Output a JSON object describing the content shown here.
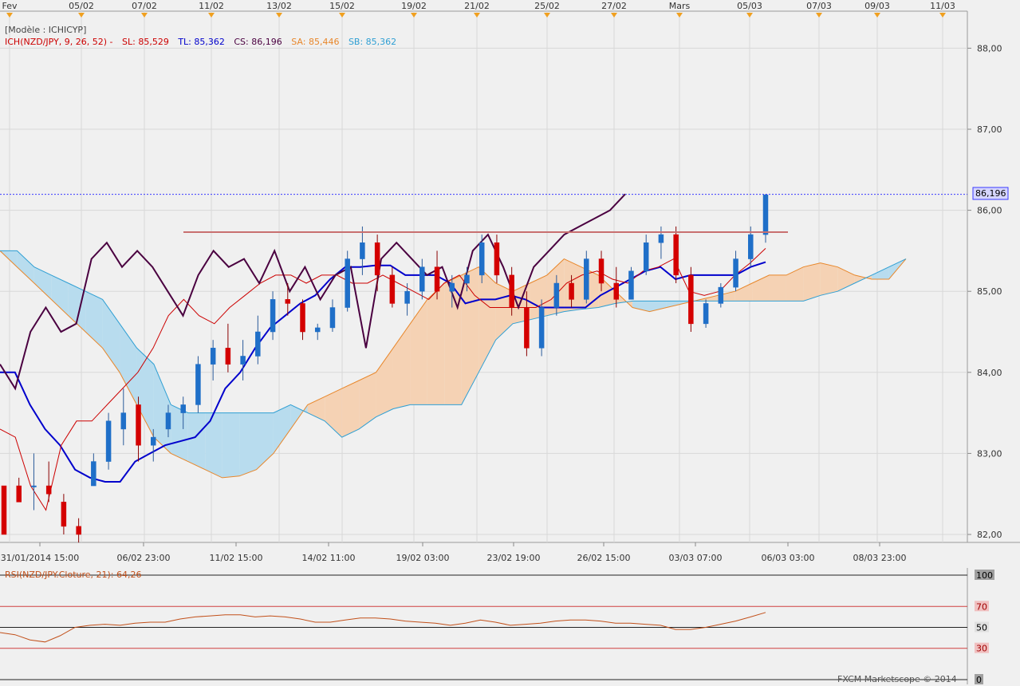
{
  "chart_data": {
    "type": "candlestick",
    "instrument": "NZD/JPY",
    "top_date_ticks": [
      "Fev",
      "05/02",
      "07/02",
      "11/02",
      "13/02",
      "15/02",
      "19/02",
      "21/02",
      "25/02",
      "27/02",
      "Mars",
      "05/03",
      "07/03",
      "09/03",
      "11/03"
    ],
    "bottom_time_ticks": [
      "31/01/2014 15:00",
      "06/02 23:00",
      "11/02 15:00",
      "14/02 11:00",
      "19/02 03:00",
      "23/02 19:00",
      "26/02 15:00",
      "03/03 07:00",
      "06/03 03:00",
      "08/03 23:00"
    ],
    "price_axis": {
      "ticks": [
        "88,00",
        "87,00",
        "86,00",
        "85,00",
        "84,00",
        "83,00",
        "82,00"
      ],
      "ylim": [
        81.95,
        88.5
      ]
    },
    "current_price_label": "86,196",
    "current_price": 86.196,
    "legend": {
      "model": "[Modèle : ICHICYP]",
      "ich": "ICH(NZD/JPY, 9, 26, 52) -",
      "sl": "SL: 85,529",
      "tl": "TL: 85,362",
      "cs": "CS: 86,196",
      "sa": "SA: 85,446",
      "sb": "SB: 85,362"
    },
    "resistance_level": 85.73,
    "series": {
      "senkou_a": [
        85.5,
        85.3,
        85.1,
        84.9,
        84.7,
        84.5,
        84.3,
        84.0,
        83.6,
        83.2,
        83.0,
        82.9,
        82.8,
        82.7,
        82.72,
        82.8,
        83.0,
        83.3,
        83.6,
        83.7,
        83.8,
        83.9,
        84.0,
        84.3,
        84.6,
        84.9,
        85.1,
        85.2,
        85.3,
        85.1,
        85.0,
        85.1,
        85.2,
        85.4,
        85.3,
        85.2,
        85.0,
        84.8,
        84.75,
        84.8,
        84.85,
        84.9,
        84.95,
        85.0,
        85.1,
        85.2,
        85.2,
        85.3,
        85.35,
        85.3,
        85.2,
        85.15,
        85.15,
        85.4,
        85.45
      ],
      "senkou_b": [
        85.5,
        85.5,
        85.3,
        85.2,
        85.1,
        85.0,
        84.9,
        84.6,
        84.3,
        84.1,
        83.6,
        83.5,
        83.5,
        83.5,
        83.5,
        83.5,
        83.5,
        83.6,
        83.5,
        83.4,
        83.2,
        83.3,
        83.45,
        83.55,
        83.6,
        83.6,
        83.6,
        83.6,
        84.0,
        84.4,
        84.6,
        84.65,
        84.7,
        84.75,
        84.78,
        84.8,
        84.85,
        84.88,
        84.88,
        84.88,
        84.88,
        84.88,
        84.88,
        84.88,
        84.88,
        84.88,
        84.88,
        84.88,
        84.95,
        85.0,
        85.1,
        85.2,
        85.3,
        85.4
      ],
      "kijun": [
        84.0,
        84.0,
        83.6,
        83.3,
        83.1,
        82.8,
        82.7,
        82.65,
        82.65,
        82.9,
        83.0,
        83.1,
        83.15,
        83.2,
        83.4,
        83.8,
        84.0,
        84.3,
        84.55,
        84.7,
        84.85,
        84.95,
        85.15,
        85.3,
        85.3,
        85.32,
        85.32,
        85.2,
        85.2,
        85.2,
        85.1,
        84.85,
        84.9,
        84.9,
        84.95,
        84.9,
        84.8,
        84.8,
        84.8,
        84.8,
        84.95,
        85.05,
        85.15,
        85.25,
        85.3,
        85.15,
        85.2,
        85.2,
        85.2,
        85.2,
        85.3,
        85.36
      ],
      "tenkan": [
        83.3,
        83.2,
        82.6,
        82.3,
        83.1,
        83.4,
        83.4,
        83.6,
        83.8,
        84.0,
        84.3,
        84.7,
        84.9,
        84.7,
        84.6,
        84.8,
        84.95,
        85.1,
        85.2,
        85.2,
        85.1,
        85.2,
        85.2,
        85.1,
        85.1,
        85.2,
        85.1,
        85.0,
        84.9,
        85.1,
        85.2,
        84.95,
        84.8,
        84.8,
        84.8,
        84.8,
        84.9,
        85.1,
        85.2,
        85.25,
        85.15,
        85.1,
        85.25,
        85.3,
        85.4,
        85.0,
        84.95,
        85.0,
        85.2,
        85.35,
        85.53
      ],
      "chikou": [
        84.1,
        83.8,
        84.5,
        84.8,
        84.5,
        84.6,
        85.4,
        85.6,
        85.3,
        85.5,
        85.3,
        85.0,
        84.7,
        85.2,
        85.5,
        85.3,
        85.4,
        85.1,
        85.5,
        85.0,
        85.3,
        84.9,
        85.2,
        85.3,
        84.3,
        85.4,
        85.6,
        85.4,
        85.2,
        85.3,
        84.8,
        85.5,
        85.7,
        85.3,
        84.8,
        85.3,
        85.5,
        85.7,
        85.8,
        85.9,
        86.0,
        86.2
      ]
    },
    "candles": [
      [
        82.6,
        82.6,
        82.3,
        82.0
      ],
      [
        82.6,
        82.7,
        82.4,
        82.4
      ],
      [
        82.6,
        83.0,
        82.3,
        82.6
      ],
      [
        82.6,
        82.9,
        82.4,
        82.5
      ],
      [
        82.4,
        82.5,
        82.0,
        82.1
      ],
      [
        82.1,
        82.2,
        81.9,
        82.0
      ],
      [
        82.6,
        83.0,
        82.6,
        82.9
      ],
      [
        82.9,
        83.5,
        82.8,
        83.4
      ],
      [
        83.3,
        83.8,
        83.1,
        83.5
      ],
      [
        83.6,
        83.7,
        82.9,
        83.1
      ],
      [
        83.1,
        83.3,
        82.9,
        83.2
      ],
      [
        83.3,
        83.6,
        83.2,
        83.5
      ],
      [
        83.5,
        83.7,
        83.3,
        83.6
      ],
      [
        83.6,
        84.2,
        83.5,
        84.1
      ],
      [
        84.1,
        84.4,
        83.9,
        84.3
      ],
      [
        84.3,
        84.6,
        84.0,
        84.1
      ],
      [
        84.1,
        84.4,
        83.9,
        84.2
      ],
      [
        84.2,
        84.7,
        84.1,
        84.5
      ],
      [
        84.5,
        85.0,
        84.4,
        84.9
      ],
      [
        84.9,
        85.1,
        84.7,
        84.85
      ],
      [
        84.85,
        84.9,
        84.4,
        84.5
      ],
      [
        84.5,
        84.6,
        84.4,
        84.55
      ],
      [
        84.55,
        84.9,
        84.5,
        84.8
      ],
      [
        84.8,
        85.5,
        84.75,
        85.4
      ],
      [
        85.4,
        85.8,
        85.2,
        85.6
      ],
      [
        85.6,
        85.7,
        85.0,
        85.2
      ],
      [
        85.2,
        85.3,
        84.8,
        84.85
      ],
      [
        84.85,
        85.1,
        84.7,
        85.0
      ],
      [
        85.0,
        85.4,
        84.9,
        85.3
      ],
      [
        85.3,
        85.5,
        84.9,
        85.0
      ],
      [
        85.0,
        85.2,
        84.8,
        85.1
      ],
      [
        85.1,
        85.3,
        85.0,
        85.2
      ],
      [
        85.2,
        85.7,
        85.1,
        85.6
      ],
      [
        85.6,
        85.7,
        85.1,
        85.2
      ],
      [
        85.2,
        85.3,
        84.7,
        84.8
      ],
      [
        84.8,
        85.0,
        84.2,
        84.3
      ],
      [
        84.3,
        84.9,
        84.2,
        84.8
      ],
      [
        84.8,
        85.2,
        84.7,
        85.1
      ],
      [
        85.1,
        85.2,
        84.8,
        84.9
      ],
      [
        84.9,
        85.5,
        84.85,
        85.4
      ],
      [
        85.4,
        85.5,
        85.0,
        85.1
      ],
      [
        85.1,
        85.3,
        84.8,
        84.9
      ],
      [
        84.9,
        85.3,
        84.9,
        85.25
      ],
      [
        85.25,
        85.7,
        85.2,
        85.6
      ],
      [
        85.6,
        85.8,
        85.4,
        85.7
      ],
      [
        85.7,
        85.8,
        85.1,
        85.2
      ],
      [
        85.2,
        85.3,
        84.5,
        84.6
      ],
      [
        84.6,
        84.9,
        84.55,
        84.85
      ],
      [
        84.85,
        85.1,
        84.8,
        85.05
      ],
      [
        85.05,
        85.5,
        85.0,
        85.4
      ],
      [
        85.4,
        85.8,
        85.3,
        85.7
      ],
      [
        85.7,
        86.2,
        85.6,
        86.19
      ]
    ],
    "rsi": {
      "label": "RSI(NZD/JPY.Cloture, 21): 64,26",
      "value": 64.26,
      "ticks": [
        "100",
        "70",
        "50",
        "30",
        "0"
      ],
      "levels": [
        70,
        50,
        30
      ],
      "ylim": [
        0,
        100
      ],
      "values": [
        45,
        43,
        38,
        36,
        42,
        50,
        52,
        53,
        52,
        54,
        55,
        55,
        58,
        60,
        61,
        62,
        62,
        60,
        61,
        60,
        58,
        55,
        55,
        57,
        59,
        59,
        58,
        56,
        55,
        54,
        52,
        54,
        57,
        55,
        52,
        53,
        54,
        56,
        57,
        57,
        56,
        54,
        54,
        53,
        52,
        48,
        48,
        50,
        53,
        56,
        60,
        64.26
      ]
    },
    "watermark": "FXCM Marketscope © 2014",
    "colors": {
      "bull": "#1f6fc8",
      "bear": "#d40000",
      "kijun": "#0000cc",
      "tenkan": "#cc0000",
      "chikou": "#4a0040",
      "senkou_a": "#e8872b",
      "senkou_b": "#2f9fd3",
      "cloud_up": "#f5d2b4",
      "cloud_down": "#b8dcee",
      "resistance": "#c87070",
      "current_price_line": "#3a3aff",
      "rsi_line": "#c2501a",
      "rsi_label": "#c2501a"
    }
  }
}
